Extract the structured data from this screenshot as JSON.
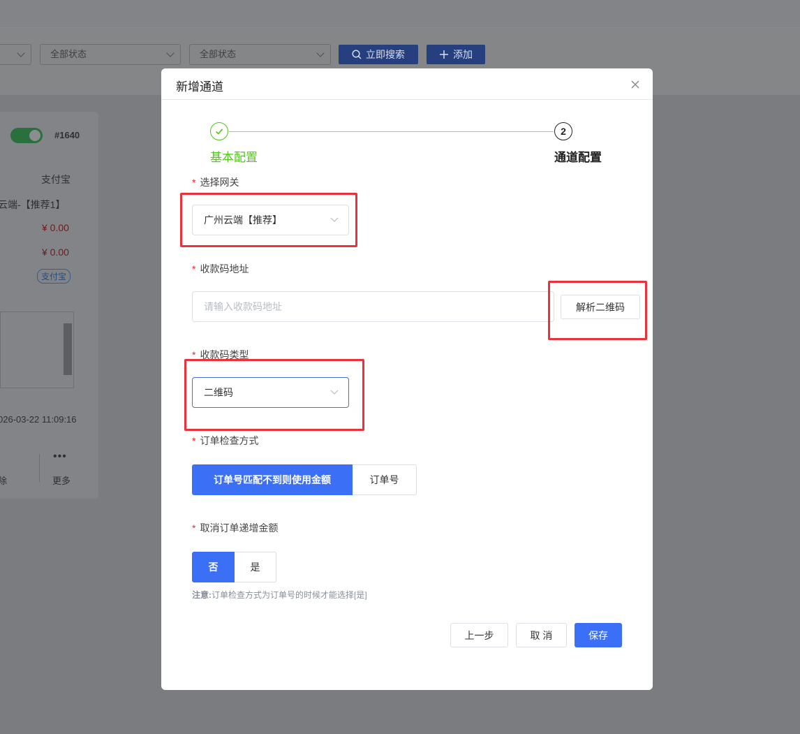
{
  "background": {
    "filters": [
      {
        "label": ""
      },
      {
        "label": "全部状态"
      },
      {
        "label": "全部状态"
      }
    ],
    "search_button": "立即搜索",
    "add_button": "添加",
    "card": {
      "id": "#1640",
      "pay_type": "支付宝",
      "gateway_name": "云端-【推荐1】",
      "amount1": "¥ 0.00",
      "amount2": "¥ 0.00",
      "tag": "支付宝",
      "timestamp": "026-03-22 11:09:16",
      "delete_label": "除",
      "more_label": "更多"
    }
  },
  "modal": {
    "title": "新增通道",
    "steps": [
      {
        "label": "基本配置",
        "status": "done"
      },
      {
        "label": "通道配置",
        "status": "current",
        "number": "2"
      }
    ],
    "gateway": {
      "label": "选择网关",
      "value": "广州云端【推荐】"
    },
    "qr_url": {
      "label": "收款码地址",
      "value": "",
      "placeholder": "请输入收款码地址",
      "parse_button": "解析二维码"
    },
    "qr_type": {
      "label": "收款码类型",
      "value": "二维码"
    },
    "order_check": {
      "label": "订单检查方式",
      "options": [
        "订单号匹配不到则使用金额",
        "订单号"
      ],
      "selected": 0
    },
    "cancel_increment": {
      "label": "取消订单递增金额",
      "options": [
        "否",
        "是"
      ],
      "selected": 0
    },
    "note": {
      "prefix": "注意:",
      "text": "订单检查方式为订单号的时候才能选择[是]"
    },
    "buttons": {
      "prev": "上一步",
      "cancel": "取 消",
      "save": "保存"
    }
  },
  "colors": {
    "primary": "#3b6ff5",
    "success": "#52c41a",
    "required": "#f5222d",
    "highlight": "#e8323c"
  }
}
